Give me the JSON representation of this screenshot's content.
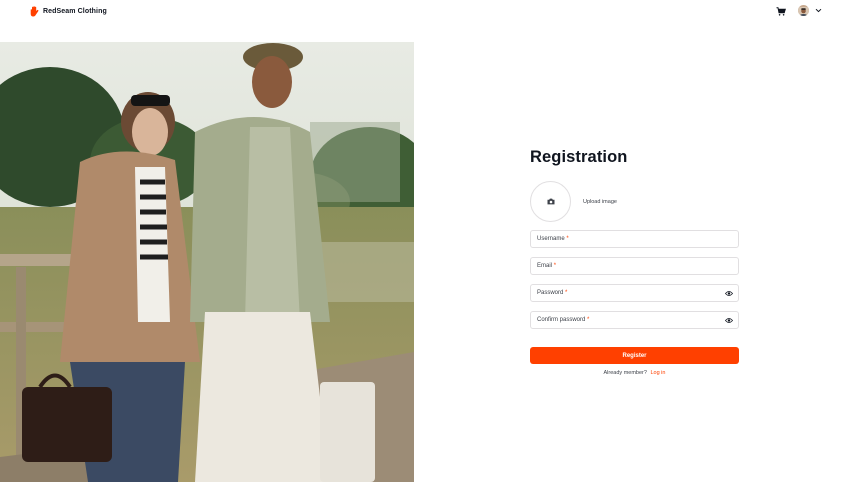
{
  "header": {
    "brand": "RedSeam Clothing",
    "icons": {
      "logo": "hand-logo-icon",
      "cart": "cart-icon",
      "avatar": "user-avatar",
      "menu": "chevron-down-icon"
    }
  },
  "form": {
    "title": "Registration",
    "upload_label": "Upload image",
    "fields": {
      "username": {
        "placeholder": "Username",
        "required_mark": "*"
      },
      "email": {
        "placeholder": "Email",
        "required_mark": "*"
      },
      "password": {
        "placeholder": "Password",
        "required_mark": "*"
      },
      "confirm_password": {
        "placeholder": "Confirm password",
        "required_mark": "*"
      }
    },
    "register_label": "Register",
    "member_text": "Already member?",
    "login_label": "Log in"
  },
  "colors": {
    "accent": "#ff4000",
    "text": "#10151f",
    "muted": "#3e424a",
    "border": "#e1dfe1"
  }
}
